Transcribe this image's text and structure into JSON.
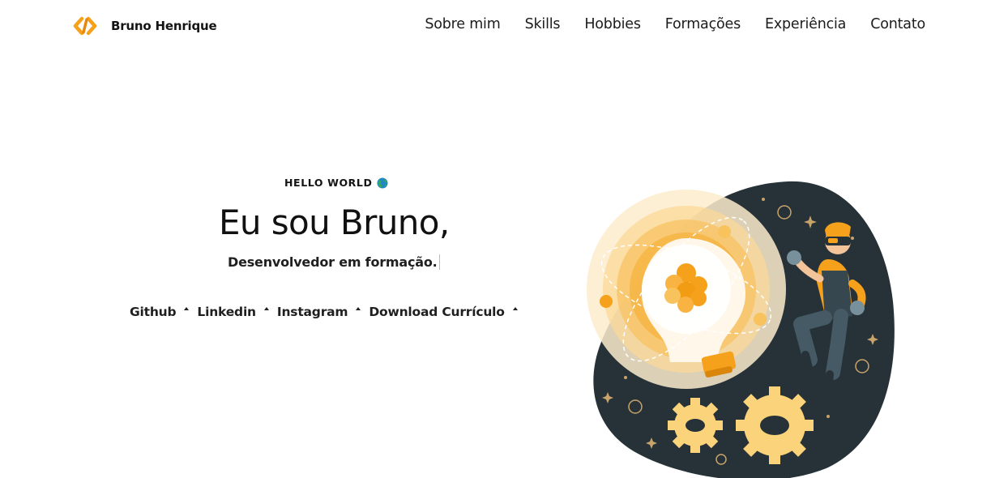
{
  "header": {
    "brand": "Bruno Henrique",
    "logo_icon": "code-brackets-icon",
    "nav": [
      "Sobre mim",
      "Skills",
      "Hobbies",
      "Formações",
      "Experiência",
      "Contato"
    ]
  },
  "hero": {
    "eyebrow": "HELLO WORLD",
    "eyebrow_icon": "globe-icon",
    "title": "Eu sou Bruno,",
    "subtitle": "Desenvolvedor em formação.",
    "links": [
      "Github",
      "Linkedin",
      "Instagram",
      "Download Currículo"
    ]
  },
  "illustration": {
    "description_icon": "lightbulb-astronaut-illustration"
  },
  "colors": {
    "accent": "#f5a11c",
    "dark_blob": "#263238",
    "text": "#141414"
  }
}
